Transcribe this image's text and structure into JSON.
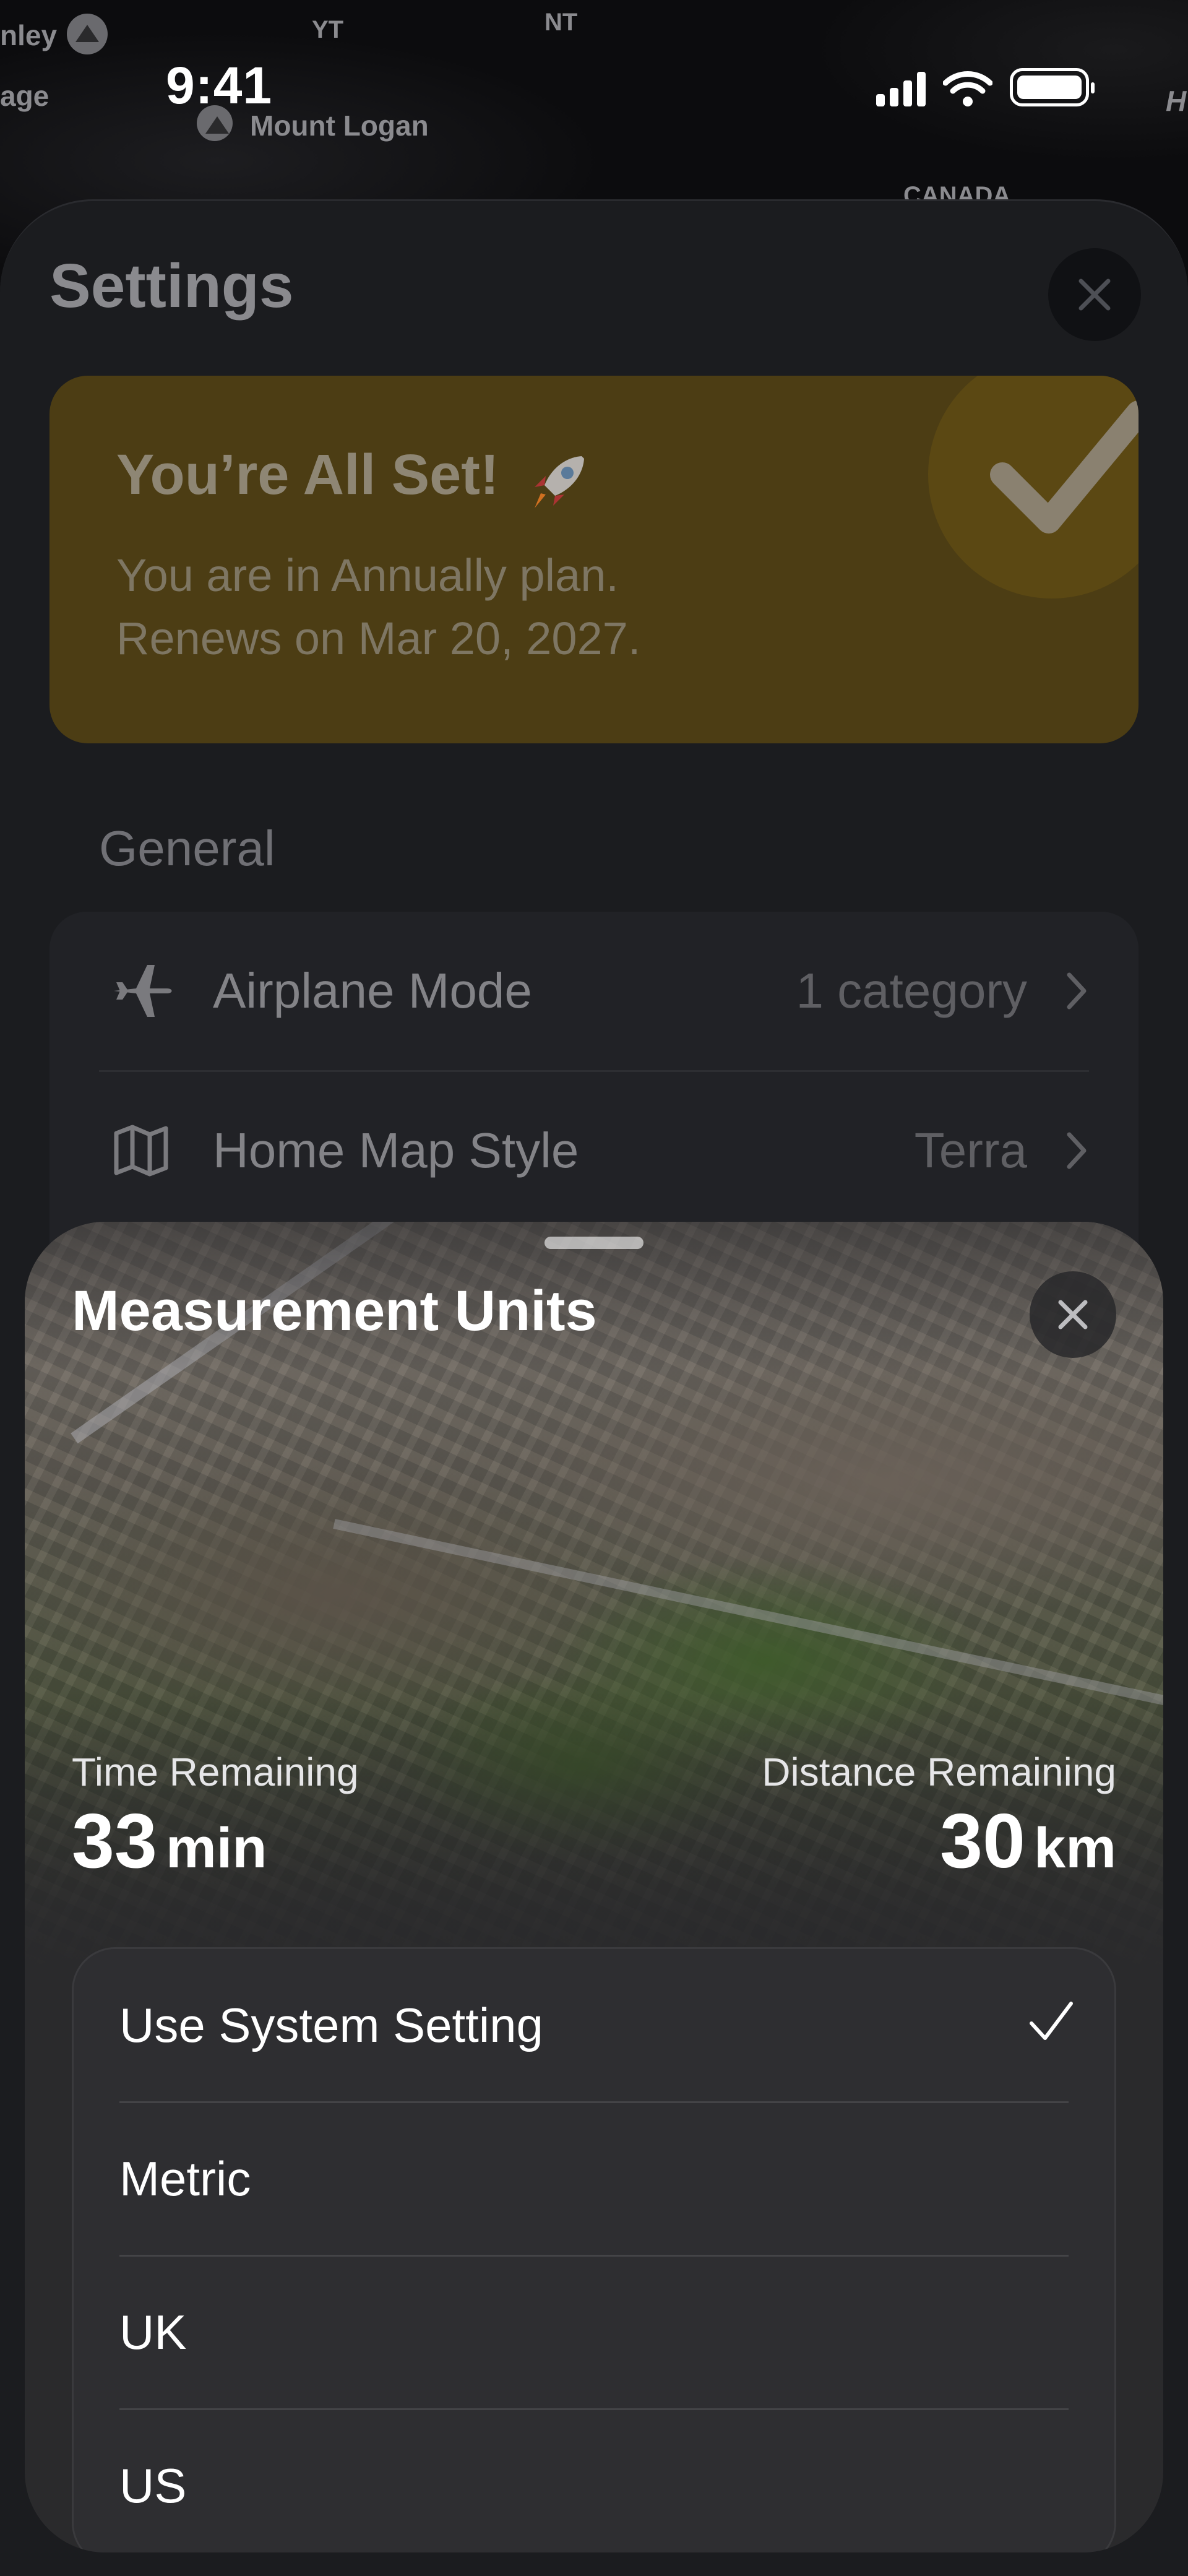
{
  "map": {
    "labels": [
      "nley",
      "age",
      "YT",
      "NT",
      "Mount Logan",
      "CANADA",
      "H"
    ]
  },
  "status_bar": {
    "time": "9:41"
  },
  "settings": {
    "title": "Settings",
    "promo": {
      "title": "You’re All Set!",
      "line1": "You are in Annually plan.",
      "line2": "Renews on Mar 20, 2027."
    },
    "section_general": "General",
    "rows": [
      {
        "label": "Airplane Mode",
        "value": "1 category",
        "icon": "airplane-icon"
      },
      {
        "label": "Home Map Style",
        "value": "Terra",
        "icon": "map-icon"
      }
    ]
  },
  "measurement_sheet": {
    "title": "Measurement Units",
    "time_remaining": {
      "label": "Time Remaining",
      "value": "33",
      "unit": "min"
    },
    "distance_remaining": {
      "label": "Distance Remaining",
      "value": "30",
      "unit": "km"
    },
    "options": [
      {
        "label": "Use System Setting",
        "selected": true
      },
      {
        "label": "Metric",
        "selected": false
      },
      {
        "label": "UK",
        "selected": false
      },
      {
        "label": "US",
        "selected": false
      }
    ]
  },
  "colors": {
    "promo_bg": "#4c3d14",
    "sheet_bg": "#1b1c1f",
    "accent_check": "#ffffff"
  }
}
